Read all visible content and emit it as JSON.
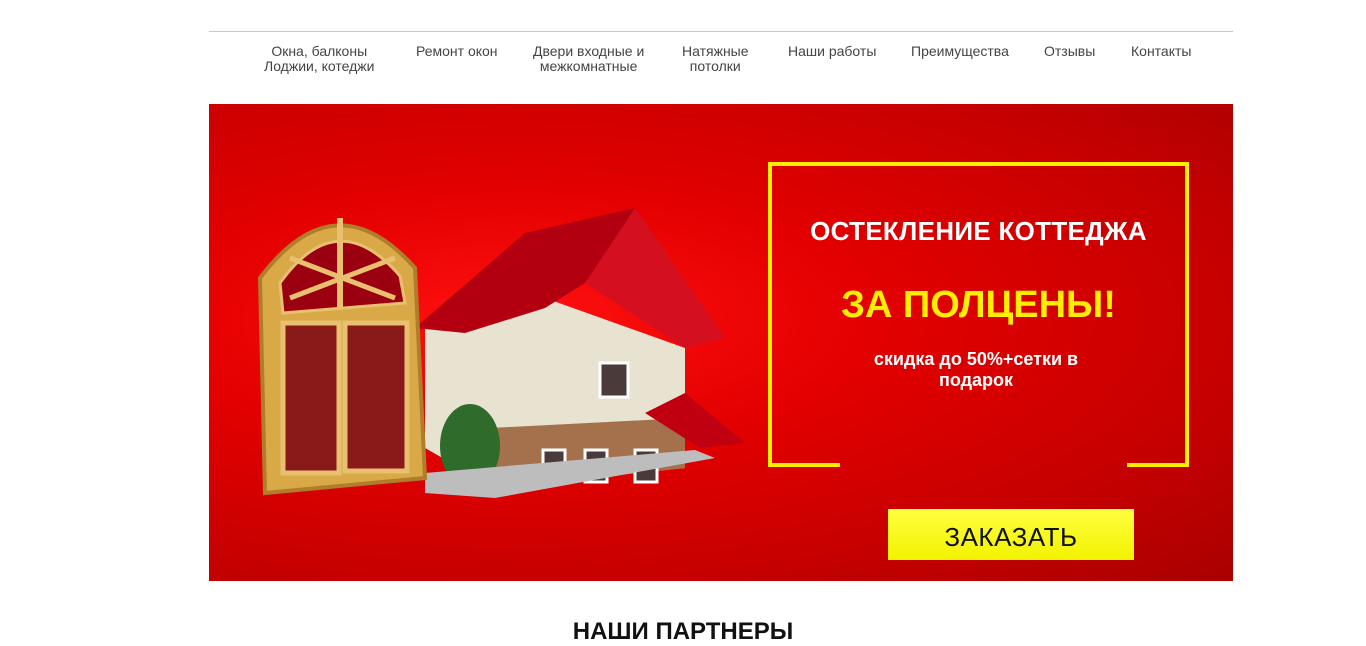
{
  "nav": {
    "items": [
      {
        "line1": "Окна, балконы",
        "line2": "Лоджии, котеджи"
      },
      {
        "line1": "Ремонт окон",
        "line2": ""
      },
      {
        "line1": "Двери входные и",
        "line2": "межкомнатные"
      },
      {
        "line1": "Натяжные",
        "line2": "потолки"
      },
      {
        "line1": "Наши работы",
        "line2": ""
      },
      {
        "line1": "Преимущества",
        "line2": ""
      },
      {
        "line1": "Отзывы",
        "line2": ""
      },
      {
        "line1": "Контакты",
        "line2": ""
      }
    ]
  },
  "hero": {
    "title": "ОСТЕКЛЕНИЕ КОТТЕДЖА",
    "headline": "ЗА ПОЛЦЕНЫ!",
    "subtitle": "скидка до 50%+сетки в подарок",
    "button_label": "ЗАКАЗАТЬ",
    "image_icon": "house-with-window-image"
  },
  "partners": {
    "title": "НАШИ ПАРТНЕРЫ"
  },
  "colors": {
    "hero_red": "#e30000",
    "accent_yellow": "#ffee00",
    "button_yellow": "#f2f200"
  }
}
